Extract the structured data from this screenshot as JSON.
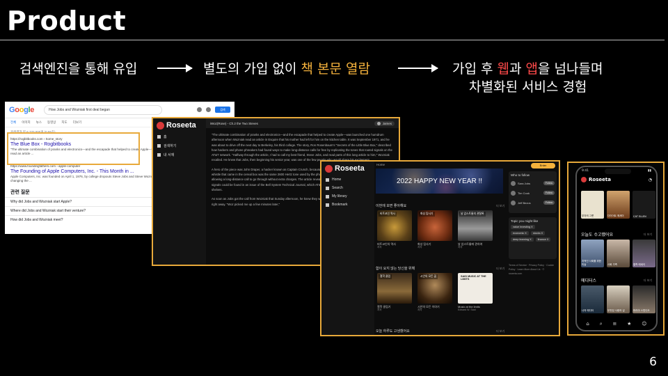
{
  "slide": {
    "title": "Product",
    "page_number": "6",
    "flow": {
      "step1": "검색엔진을 통해 유입",
      "step2_prefix": "별도의 가입 없이 ",
      "step2_highlight": "책 본문 열람",
      "step3_a": "가입 후 ",
      "step3_web": "웹",
      "step3_b": "과 ",
      "step3_app": "앱",
      "step3_c": "을 넘나들며",
      "step3_line2": "차별화된 서비스 경험"
    }
  },
  "colors": {
    "highlight": "#f5b23c",
    "accent_red": "#ff4a4a",
    "frame": "#e8a93a"
  },
  "google": {
    "logo": "Google",
    "query": "How Jobs and Wozniak first deal began",
    "search_button": "검색",
    "tabs": [
      "전체",
      "이미지",
      "뉴스",
      "동영상",
      "지도",
      "더보기"
    ],
    "result_count": "검색결과 약 6,770,000개 (0.55초)",
    "result1_url": "https://rogbitbooks.com › Some_story",
    "result1_title": "The Blue Box - Rogbitbooks",
    "result1_snippet": "\"The ultimate combination of pranks and electronics—and the escapade that helped to create Apple—was launched one humdrum afternoon when Wozniak read an article ...",
    "result2_url": "https://www.foundingfathers.com › apple-computer",
    "result2_title": "The Founding of Apple Computers, Inc. - This Month in ...",
    "result2_snippet": "Apple Computers, Inc. was founded on April 1, 1976, by college dropouts Steve Jobs and Steve Wozniak, who brought to the new company a vision of changing the ...",
    "faq_title": "관련 질문",
    "faq": [
      "Why did Jobs and Wozniak start Apple?",
      "Where did Jobs and Wozniak start their venture?",
      "How did Jobs and Wozniak meet?"
    ]
  },
  "reader": {
    "brand": "Roseeta",
    "nav": [
      "홈",
      "검색하기",
      "내 서재"
    ],
    "chapter": "iWoz(Rose) - Ch.2 the Two Steves",
    "user": "James",
    "paragraphs": [
      "\"The ultimate combination of pranks and electronics—and the escapade that helped to create Apple—was launched one humdrum afternoon when Wozniak read an article in Esquire that his mother had left for him on the kitchen table. It was September 1971, and he was about to drive off the next day to Berkeley, his third college. The story, Ron Rosenbaum's \"Secrets of the Little Blue Box,\" described how hackers and phone phreakers had found ways to make long-distance calls for free by replicating the tones that routed signals on the AT&T network. \"Halfway through the article, I had to call my best friend, Steve Jobs, and read parts of this long article to him,\" Wozniak recalled. He knew that Jobs, then beginning his senior year, was one of the few people who would share his excitement.",
      "A hero of the piece was John Draper, a hacker known as Captain Crunch, because he had discovered that the sound emitted by the toy whistle that came in the cereal box was the same 2600 Hertz tone used by the phone network's switching. It could fool the system into allowing a long-distance call to go through without extra charges. The article revealed that other tones that served as single-frequency signals could be found in an issue of the Bell System Technical Journal, which AT&T immediately began asking libraries to pull from their shelves.",
      "As soon as Jobs got the call from Wozniak that Sunday afternoon, he knew they would have to get their hands on the technical journal right away. \"Woz picked me up a few minutes later,\""
    ]
  },
  "home": {
    "brand": "Roseeta",
    "nav": [
      "Home",
      "Search",
      "My library",
      "Bookmark"
    ],
    "crumb": "Home",
    "banner": "2022 HAPPY NEW YEAR !!",
    "login": "Enter",
    "sections": [
      {
        "title": "이번에 보면 좋아해요",
        "more": "더 보기",
        "items": [
          {
            "cover": "비트코인 역사",
            "caption": "비트코인의 역사",
            "sub": "저자"
          },
          {
            "cover": "화성 탐사기",
            "caption": "화성 탐사기",
            "sub": "저자"
          },
          {
            "cover": "날 암스트롱의 관찰록",
            "caption": "날 암스트롱에 관하여",
            "sub": "저자"
          }
        ]
      },
      {
        "title": "함이 요지 않는 당신을 위해",
        "more": "더 보기",
        "items": [
          {
            "cover": "철학 클럽",
            "caption": "철학 클럽기",
            "sub": "저자"
          },
          {
            "cover": "시안의 모든 꿈",
            "caption": "시안의 모든 이야기",
            "sub": "저자"
          },
          {
            "cover": "SAID MUSIC AT THE LIMITS",
            "caption": "Music at the limits",
            "sub": "Edward W. Said"
          }
        ]
      }
    ],
    "bottom_title": "오늘 하루도 고생했어요",
    "follow_title": "Who to follow",
    "follow": [
      {
        "name": "Sara Jobs",
        "btn": "Follow"
      },
      {
        "name": "Tim Cook",
        "btn": "Follow"
      },
      {
        "name": "Jeff Bezos",
        "btn": "Follow"
      }
    ],
    "topics_title": "Topic you might like",
    "topics": [
      "value investing X",
      "economic X",
      "stocks X",
      "deep learning X",
      "finance X"
    ],
    "footer": "Terms of Service · Privacy Policy · Cookie Policy · Learn More About Us · © roseeta.com"
  },
  "phone": {
    "time": "9:41",
    "brand": "Roseeta",
    "sec1": "오늘도 수고했어요",
    "sec2": "에디터스",
    "more": "더 보기",
    "row1": [
      "부자의 그릇",
      "다이어트 에세이",
      "CAT ELLEN"
    ],
    "row2": [
      "지적인 사회를 위한 미술",
      "사회 가족",
      "철학 에세이"
    ],
    "row3": [
      "나의 에디터",
      "부잣집 사람의 길",
      "마리아 스튜디오"
    ],
    "tabs": [
      "⌂",
      "⌕",
      "≡",
      "★",
      "☺"
    ]
  }
}
